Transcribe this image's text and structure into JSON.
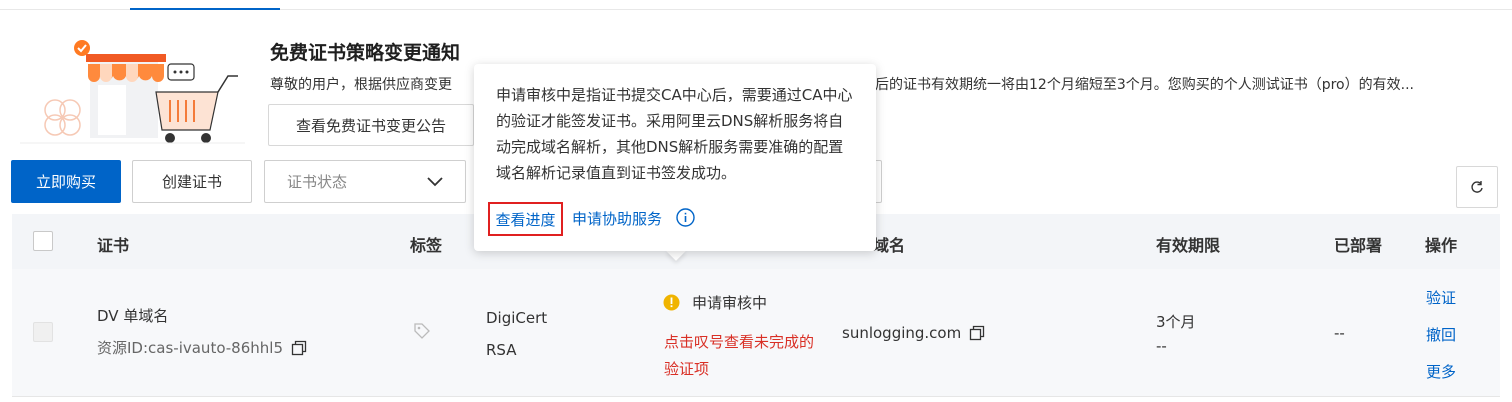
{
  "notice": {
    "title": "免费证书策略变更通知",
    "text_left": "尊敬的用户，根据供应商变更",
    "text_right": "后的证书有效期统一将由12个月缩短至3个月。您购买的个人测试证书（pro）的有效...",
    "button": "查看免费证书变更公告"
  },
  "toolbar": {
    "buy": "立即购买",
    "create": "创建证书",
    "status_placeholder": "证书状态"
  },
  "table": {
    "headers": {
      "cert": "证书",
      "tag": "标签",
      "domain": "域名",
      "validity": "有效期限",
      "deployed": "已部署",
      "actions": "操作"
    },
    "rows": [
      {
        "name": "DV 单域名",
        "resource_id": "资源ID:cas-ivauto-86hhl5",
        "brand": "DigiCert",
        "algorithm": "RSA",
        "status": "申请审核中",
        "status_hint": "点击叹号查看未完成的验证项",
        "domain": "sunlogging.com",
        "validity": "3个月",
        "validity_end": "--",
        "deployed": "--",
        "actions": [
          "验证",
          "撤回",
          "更多"
        ]
      }
    ]
  },
  "popover": {
    "text": "申请审核中是指证书提交CA中心后，需要通过CA中心的验证才能签发证书。采用阿里云DNS解析服务将自动完成域名解析，其他DNS解析服务需要准确的配置域名解析记录值直到证书签发成功。",
    "link_progress": "查看进度",
    "link_assist": "申请协助服务"
  },
  "colors": {
    "primary": "#0064c8",
    "warning": "#f0b400",
    "error": "#d93026",
    "highlight_box": "#e02020"
  }
}
